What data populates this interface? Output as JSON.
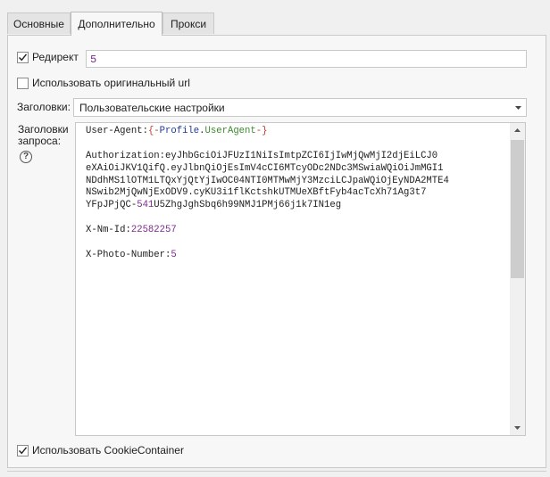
{
  "tabs": [
    {
      "label": "Основные",
      "active": false
    },
    {
      "label": "Дополнительно",
      "active": true
    },
    {
      "label": "Прокси",
      "active": false
    }
  ],
  "redirect": {
    "label": "Редирект",
    "checked": true,
    "value": "5"
  },
  "use_original_url": {
    "label": "Использовать оригинальный url",
    "checked": false
  },
  "headers_mode": {
    "label": "Заголовки:",
    "selected": "Пользовательские настройки"
  },
  "request_headers": {
    "label_line1": "Заголовки",
    "label_line2": "запроса:",
    "help_icon": "question-circle-icon",
    "lines": [
      [
        {
          "t": "User-Agent:",
          "c": "k"
        },
        {
          "t": "{-",
          "c": "r"
        },
        {
          "t": "Profile",
          "c": "b"
        },
        {
          "t": ".",
          "c": "k"
        },
        {
          "t": "UserAgent",
          "c": "g"
        },
        {
          "t": "-}",
          "c": "r"
        }
      ],
      [],
      [
        {
          "t": "Authorization:eyJhbGciOiJFUzI1NiIsImtpZCI6IjIwMjQwMjI2djEiLCJ0",
          "c": "k"
        }
      ],
      [
        {
          "t": "eXAiOiJKV1QifQ.eyJlbnQiOjEsImV4cCI6MTcyODc2NDc3MSwiaWQiOiJmMGI1",
          "c": "k"
        }
      ],
      [
        {
          "t": "NDdhMS1lOTM1LTQxYjQtYjIwOC04NTI0MTMwMjY3MzciLCJpaWQiOjEyNDA2MTE4",
          "c": "k"
        }
      ],
      [
        {
          "t": "NSwib2MjQwNjExODV9.cyKU3i1flKctshkUTMUeXBftFyb4acTcXh71Ag3t7",
          "c": "k"
        }
      ],
      [
        {
          "t": "YFpJPjQC-",
          "c": "k"
        },
        {
          "t": "541",
          "c": "n"
        },
        {
          "t": "U5ZhgJghSbq6h99NMJ1PMj66j1k7IN1eg",
          "c": "k"
        }
      ],
      [],
      [
        {
          "t": "X-Nm-Id:",
          "c": "k"
        },
        {
          "t": "22582257",
          "c": "n"
        }
      ],
      [],
      [
        {
          "t": "X-Photo-Number:",
          "c": "k"
        },
        {
          "t": "5",
          "c": "n"
        }
      ]
    ]
  },
  "cookie_container": {
    "label": "Использовать CookieContainer",
    "checked": true
  },
  "icons": {
    "checkmark": "checkmark-icon",
    "dropdown": "chevron-down-icon",
    "scroll_up": "scroll-up-arrow-icon",
    "scroll_down": "scroll-down-arrow-icon"
  },
  "colors": {
    "string": "#7a2a8a",
    "macro_brace": "#c0392b",
    "object": "#1f3aa0",
    "property": "#3c8a2e"
  }
}
